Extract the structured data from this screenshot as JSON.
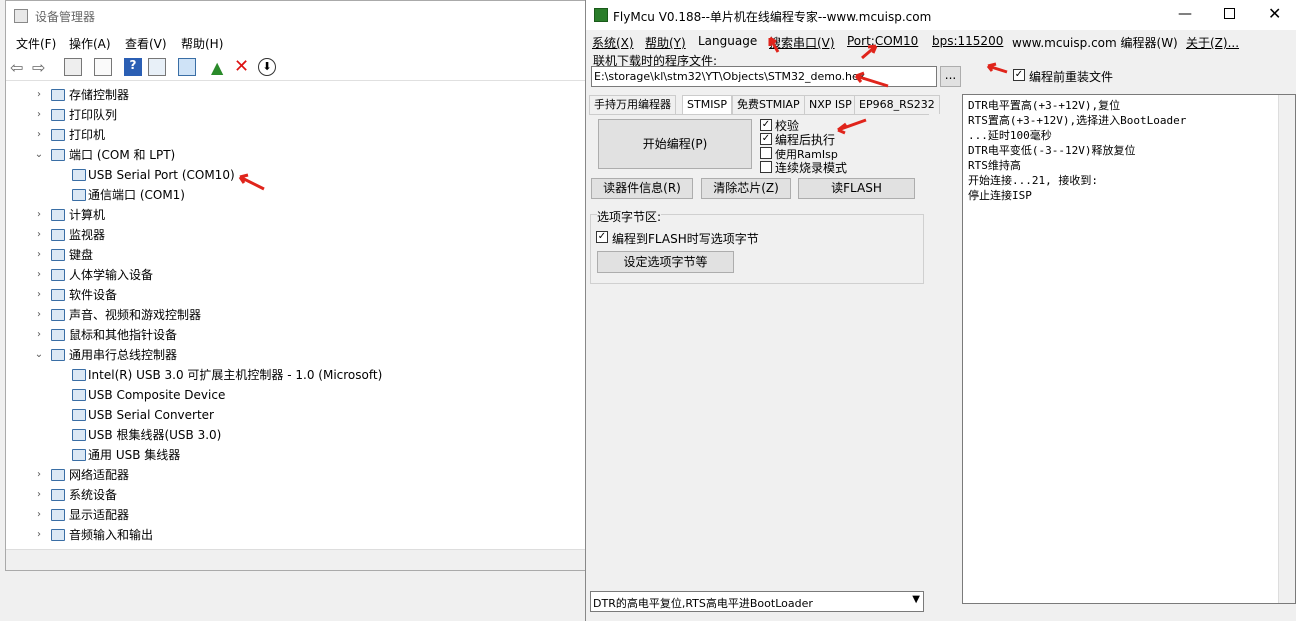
{
  "device_manager": {
    "title": "设备管理器",
    "menu": [
      "文件(F)",
      "操作(A)",
      "查看(V)",
      "帮助(H)"
    ],
    "tree": [
      {
        "label": "存储控制器",
        "exp": "›"
      },
      {
        "label": "打印队列",
        "exp": "›"
      },
      {
        "label": "打印机",
        "exp": "›"
      },
      {
        "label": "端口 (COM 和 LPT)",
        "exp": "⌄"
      },
      {
        "label": "USB Serial Port (COM10)",
        "exp": ""
      },
      {
        "label": "通信端口 (COM1)",
        "exp": ""
      },
      {
        "label": "计算机",
        "exp": "›"
      },
      {
        "label": "监视器",
        "exp": "›"
      },
      {
        "label": "键盘",
        "exp": "›"
      },
      {
        "label": "人体学输入设备",
        "exp": "›"
      },
      {
        "label": "软件设备",
        "exp": "›"
      },
      {
        "label": "声音、视频和游戏控制器",
        "exp": "›"
      },
      {
        "label": "鼠标和其他指针设备",
        "exp": "›"
      },
      {
        "label": "通用串行总线控制器",
        "exp": "⌄"
      },
      {
        "label": "Intel(R) USB 3.0 可扩展主机控制器 - 1.0 (Microsoft)",
        "exp": ""
      },
      {
        "label": "USB Composite Device",
        "exp": ""
      },
      {
        "label": "USB Serial Converter",
        "exp": ""
      },
      {
        "label": "USB 根集线器(USB 3.0)",
        "exp": ""
      },
      {
        "label": "通用 USB 集线器",
        "exp": ""
      },
      {
        "label": "网络适配器",
        "exp": "›"
      },
      {
        "label": "系统设备",
        "exp": "›"
      },
      {
        "label": "显示适配器",
        "exp": "›"
      },
      {
        "label": "音频输入和输出",
        "exp": "›"
      }
    ]
  },
  "flymcu": {
    "title": "FlyMcu V0.188--单片机在线编程专家--www.mcuisp.com",
    "menu": {
      "sys": "系统(X)",
      "help": "帮助(Y)",
      "lang": "Language",
      "search": "搜索串口(V)",
      "port": "Port:COM10",
      "bps": "bps:115200",
      "site": "www.mcuisp.com 编程器(W)",
      "about": "关于(Z)..."
    },
    "file_label": "联机下载时的程序文件:",
    "file_path": "E:\\storage\\kl\\stm32\\YT\\Objects\\STM32_demo.hex",
    "browse": "...",
    "reload": "编程前重装文件",
    "tabs": [
      "手持万用编程器",
      "STMISP",
      "免费STMIAP",
      "NXP ISP",
      "EP968_RS232"
    ],
    "start": "开始编程(P)",
    "verify": "校验",
    "run_after": "编程后执行",
    "use_ram": "使用RamIsp",
    "continuous": "连续烧录模式",
    "read_info": "读器件信息(R)",
    "erase": "清除芯片(Z)",
    "read_flash": "读FLASH",
    "option_title": "选项字节区:",
    "option_write": "编程到FLASH时写选项字节",
    "option_btn": "设定选项字节等",
    "dtr_select": "DTR的高电平复位,RTS高电平进BootLoader",
    "log": [
      "DTR电平置高(+3-+12V),复位",
      "RTS置高(+3-+12V),选择进入BootLoader",
      "...延时100毫秒",
      "DTR电平变低(-3--12V)释放复位",
      "RTS维持高",
      "开始连接...21, 接收到:",
      "停止连接ISP"
    ]
  }
}
